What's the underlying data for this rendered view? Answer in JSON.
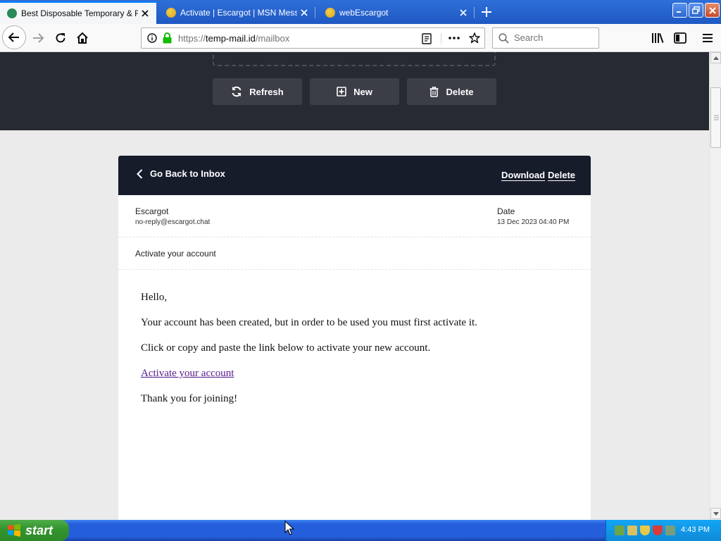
{
  "browser": {
    "tabs": [
      {
        "title": "Best Disposable Temporary & Fake",
        "active": true,
        "favicon_color": "#2a8a5a"
      },
      {
        "title": "Activate | Escargot | MSN Messen",
        "active": false,
        "favicon_color": "#e2b634"
      },
      {
        "title": "webEscargot",
        "active": false,
        "favicon_color": "#e2b634"
      }
    ],
    "url_prefix": "https://",
    "url_host": "temp-mail.id",
    "url_path": "/mailbox",
    "search_placeholder": "Search"
  },
  "toolbar": {
    "refresh_label": "Refresh",
    "new_label": "New",
    "delete_label": "Delete"
  },
  "email": {
    "back_label": "Go Back to Inbox",
    "download_label": "Download",
    "delete_label": "Delete",
    "sender_name": "Escargot",
    "sender_email": "no-reply@escargot.chat",
    "date_label": "Date",
    "date_value": "13 Dec 2023 04:40 PM",
    "subject": "Activate your account",
    "body": {
      "greeting": "Hello,",
      "line1": "Your account has been created, but in order to be used you must first activate it.",
      "line2": "Click or copy and paste the link below to activate your new account.",
      "link_text": "Activate your account",
      "closing": "Thank you for joining!"
    }
  },
  "taskbar": {
    "start_label": "start",
    "clock": "4:43 PM"
  },
  "colors": {
    "hero_bg": "#282a33",
    "card_header_bg": "#171c2b",
    "link_visited": "#551a8b",
    "secure_lock": "#12bc00"
  }
}
